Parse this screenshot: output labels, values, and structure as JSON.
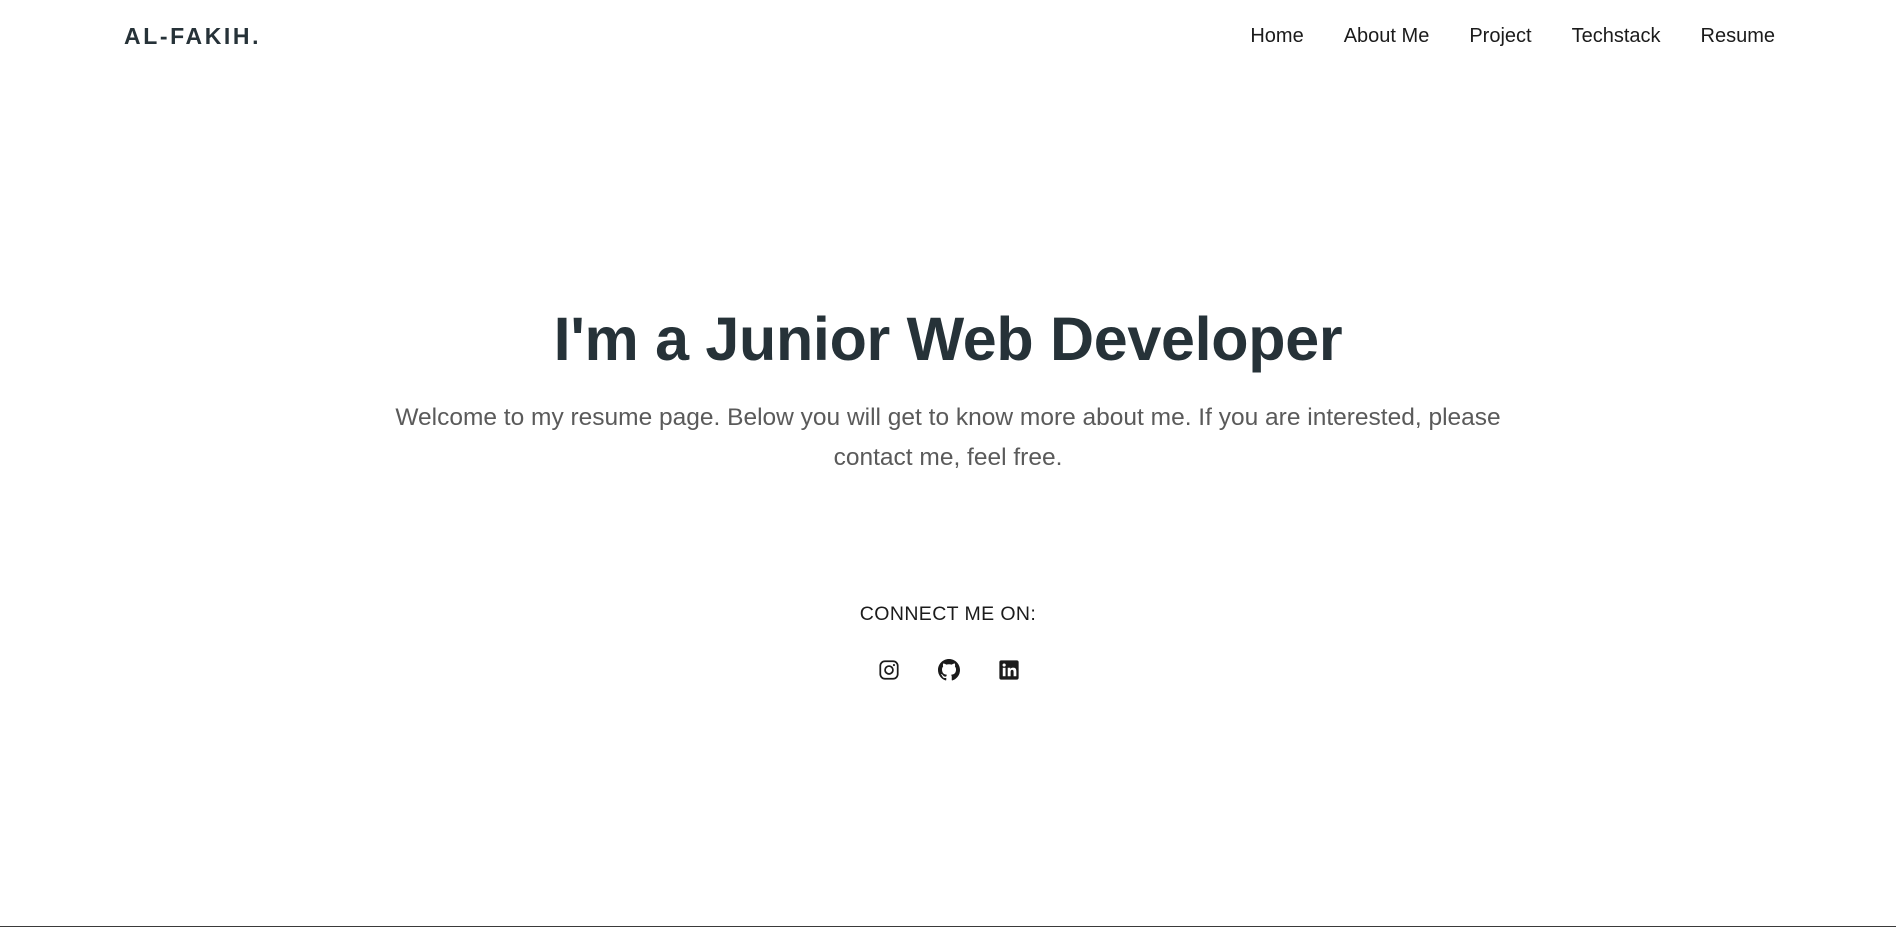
{
  "header": {
    "brand": "AL-FAKIH.",
    "nav": [
      {
        "label": "Home"
      },
      {
        "label": "About Me"
      },
      {
        "label": "Project"
      },
      {
        "label": "Techstack"
      },
      {
        "label": "Resume"
      }
    ]
  },
  "hero": {
    "title": "I'm a Junior Web Developer",
    "subtitle": "Welcome to my resume page. Below you will get to know more about me. If you are interested, please contact me, feel free."
  },
  "connect": {
    "label": "CONNECT ME ON:",
    "icons": [
      "instagram-icon",
      "github-icon",
      "linkedin-icon"
    ]
  },
  "colors": {
    "heading": "#263238",
    "body_text": "#5a5a5a",
    "background": "#ffffff"
  }
}
